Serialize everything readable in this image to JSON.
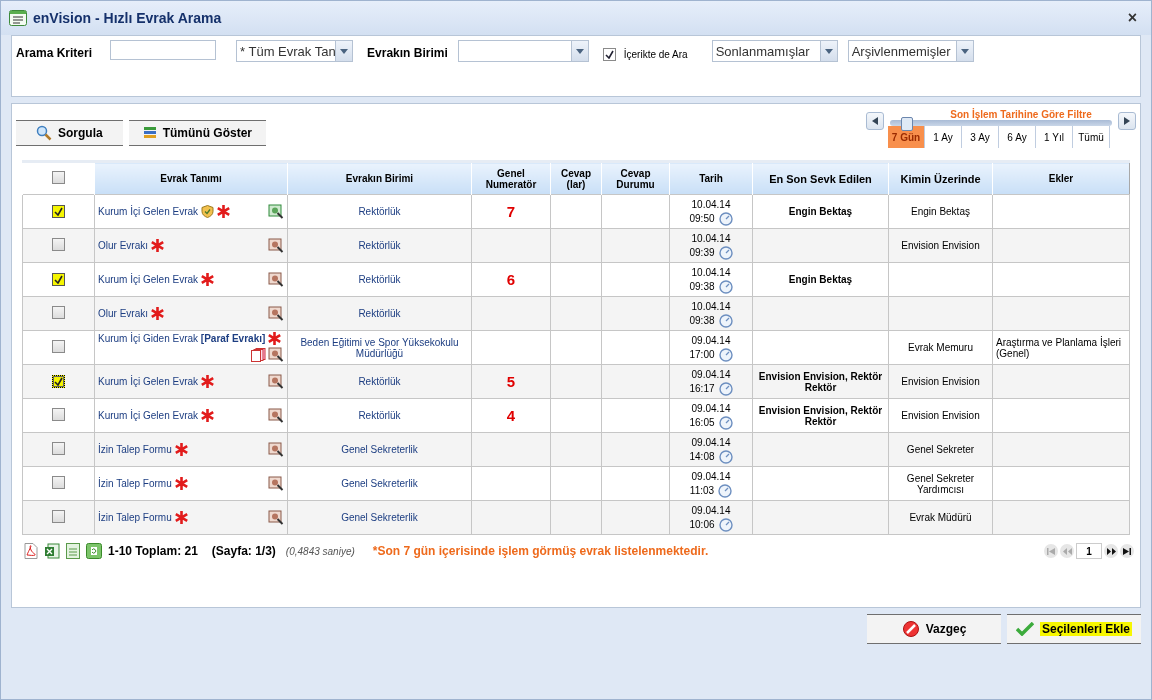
{
  "window": {
    "title": "enVision - Hızlı Evrak Arama",
    "close": "×"
  },
  "filters": {
    "criteria_label": "Arama Kriteri",
    "type_select": "* Tüm Evrak Tan",
    "unit_label": "Evrakın Birimi",
    "content_search": {
      "label": "İçerikte de Ara",
      "checked": true
    },
    "status_select": "Sonlanmamışlar",
    "archive_select": "Arşivlenmemişler"
  },
  "toolbar": {
    "buttons": [
      "Sorgula",
      "Tümünü Göster"
    ]
  },
  "date_filter": {
    "title": "Son İşlem Tarihine Göre Filtre",
    "stops": [
      {
        "label": "7 Gün",
        "selected": true
      },
      {
        "label": "1 Ay",
        "selected": false
      },
      {
        "label": "3 Ay",
        "selected": false
      },
      {
        "label": "6 Ay",
        "selected": false
      },
      {
        "label": "1 Yıl",
        "selected": false
      },
      {
        "label": "Tümü",
        "selected": false
      }
    ]
  },
  "table": {
    "select_all": false,
    "columns": [
      "Evrak Tanımı",
      "Evrakın Birimi",
      "Genel Numeratör",
      "Cevap (lar)",
      "Cevap Durumu",
      "Tarih",
      "En Son Sevk Edilen",
      "Kimin Üzerinde",
      "Ekler"
    ],
    "rows": [
      {
        "checked": true,
        "focused": false,
        "title": "Kurum İçi Gelen Evrak",
        "tag": "",
        "shield": true,
        "copies": false,
        "viewed": true,
        "unit": "Rektörlük",
        "number": "7",
        "date": "10.04.14",
        "time": "09:50",
        "last_sent": "Engin Bektaş",
        "holder": "Engin Bektaş",
        "attachments": ""
      },
      {
        "checked": false,
        "focused": false,
        "title": "Olur Evrakı",
        "tag": "",
        "shield": false,
        "copies": false,
        "viewed": false,
        "unit": "Rektörlük",
        "number": "",
        "date": "10.04.14",
        "time": "09:39",
        "last_sent": "",
        "holder": "Envision Envision",
        "attachments": ""
      },
      {
        "checked": true,
        "focused": false,
        "title": "Kurum İçi Gelen Evrak",
        "tag": "",
        "shield": false,
        "copies": false,
        "viewed": false,
        "unit": "Rektörlük",
        "number": "6",
        "date": "10.04.14",
        "time": "09:38",
        "last_sent": "Engin Bektaş",
        "holder": "",
        "attachments": ""
      },
      {
        "checked": false,
        "focused": false,
        "title": "Olur Evrakı",
        "tag": "",
        "shield": false,
        "copies": false,
        "viewed": false,
        "unit": "Rektörlük",
        "number": "",
        "date": "10.04.14",
        "time": "09:38",
        "last_sent": "",
        "holder": "",
        "attachments": ""
      },
      {
        "checked": false,
        "focused": false,
        "title": "Kurum İçi Giden Evrak",
        "tag": "[Paraf Evrakı]",
        "shield": false,
        "copies": true,
        "viewed": false,
        "unit": "Beden Eğitimi ve Spor Yüksekokulu Müdürlüğü",
        "number": "",
        "date": "09.04.14",
        "time": "17:00",
        "last_sent": "",
        "holder": "Evrak Memuru",
        "attachments": "Araştırma ve Planlama İşleri (Genel)"
      },
      {
        "checked": true,
        "focused": true,
        "title": "Kurum İçi Gelen Evrak",
        "tag": "",
        "shield": false,
        "copies": false,
        "viewed": false,
        "unit": "Rektörlük",
        "number": "5",
        "date": "09.04.14",
        "time": "16:17",
        "last_sent": "Envision Envision, Rektör Rektör",
        "holder": "Envision Envision",
        "attachments": ""
      },
      {
        "checked": false,
        "focused": false,
        "title": "Kurum İçi Gelen Evrak",
        "tag": "",
        "shield": false,
        "copies": false,
        "viewed": false,
        "unit": "Rektörlük",
        "number": "4",
        "date": "09.04.14",
        "time": "16:05",
        "last_sent": "Envision Envision, Rektör Rektör",
        "holder": "Envision Envision",
        "attachments": ""
      },
      {
        "checked": false,
        "focused": false,
        "title": "İzin Talep Formu",
        "tag": "",
        "shield": false,
        "copies": false,
        "viewed": false,
        "unit": "Genel Sekreterlik",
        "number": "",
        "date": "09.04.14",
        "time": "14:08",
        "last_sent": "",
        "holder": "Genel Sekreter",
        "attachments": ""
      },
      {
        "checked": false,
        "focused": false,
        "title": "İzin Talep Formu",
        "tag": "",
        "shield": false,
        "copies": false,
        "viewed": false,
        "unit": "Genel Sekreterlik",
        "number": "",
        "date": "09.04.14",
        "time": "11:03",
        "last_sent": "",
        "holder": "Genel Sekreter Yardımcısı",
        "attachments": ""
      },
      {
        "checked": false,
        "focused": false,
        "title": "İzin Talep Formu",
        "tag": "",
        "shield": false,
        "copies": false,
        "viewed": false,
        "unit": "Genel Sekreterlik",
        "number": "",
        "date": "09.04.14",
        "time": "10:06",
        "last_sent": "",
        "holder": "Evrak Müdürü",
        "attachments": ""
      }
    ]
  },
  "footer": {
    "range": "1-10 Toplam: 21",
    "page": "(Sayfa: 1/3)",
    "duration": "(0,4843 saniye)",
    "note": "*Son 7 gün içerisinde işlem görmüş evrak listelenmektedir.",
    "page_input": "1"
  },
  "actions": [
    {
      "label": "Vazgeç",
      "kind": "cancel",
      "highlighted": false
    },
    {
      "label": "Seçilenleri Ekle",
      "kind": "confirm",
      "highlighted": true
    }
  ]
}
